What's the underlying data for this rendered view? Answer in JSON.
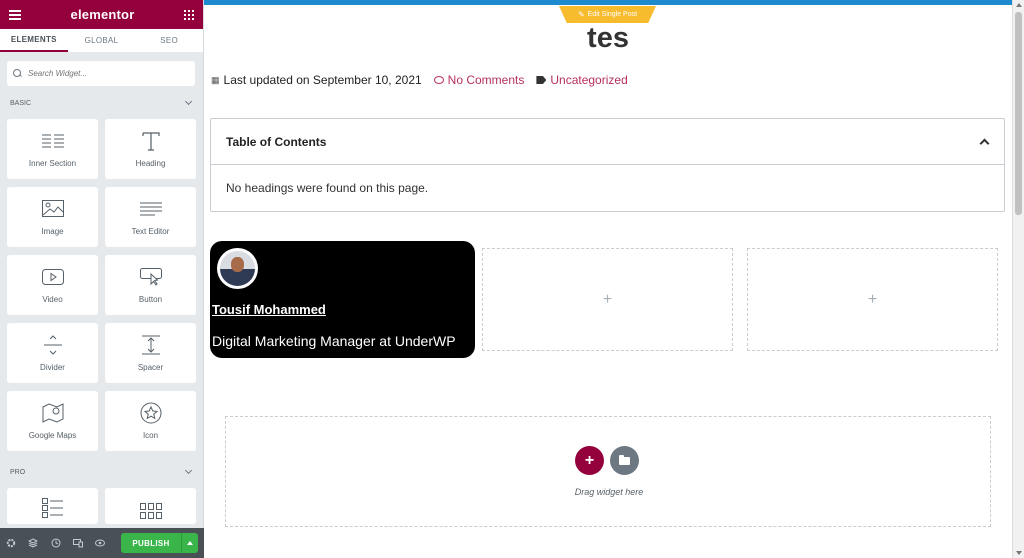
{
  "colors": {
    "brand": "#93003c",
    "accent_blue": "#1d8acf",
    "badge": "#f7bb2e",
    "publish": "#39b54a",
    "link": "#b6305f"
  },
  "sidebar": {
    "logo": "elementor",
    "tabs": [
      {
        "label": "ELEMENTS",
        "active": true
      },
      {
        "label": "GLOBAL"
      },
      {
        "label": "SEO"
      }
    ],
    "search_placeholder": "Search Widget...",
    "sections": {
      "basic": "BASIC",
      "pro": "PRO"
    },
    "widgets": [
      {
        "label": "Inner Section",
        "icon": "inner-section-icon"
      },
      {
        "label": "Heading",
        "icon": "heading-icon"
      },
      {
        "label": "Image",
        "icon": "image-icon"
      },
      {
        "label": "Text Editor",
        "icon": "text-editor-icon"
      },
      {
        "label": "Video",
        "icon": "video-icon"
      },
      {
        "label": "Button",
        "icon": "button-icon"
      },
      {
        "label": "Divider",
        "icon": "divider-icon"
      },
      {
        "label": "Spacer",
        "icon": "spacer-icon"
      },
      {
        "label": "Google Maps",
        "icon": "google-maps-icon"
      },
      {
        "label": "Icon",
        "icon": "star-icon"
      }
    ],
    "publish_label": "PUBLISH"
  },
  "preview": {
    "edit_badge": "Edit Single Post",
    "title": "tes",
    "meta": {
      "updated": "Last updated on September 10, 2021",
      "comments": "No Comments",
      "category": "Uncategorized"
    },
    "toc": {
      "title": "Table of Contents",
      "empty": "No headings were found on this page."
    },
    "author": {
      "name": "Tousif Mohammed",
      "role": "Digital Marketing Manager at UnderWP"
    },
    "drop_label": "Drag widget here"
  }
}
